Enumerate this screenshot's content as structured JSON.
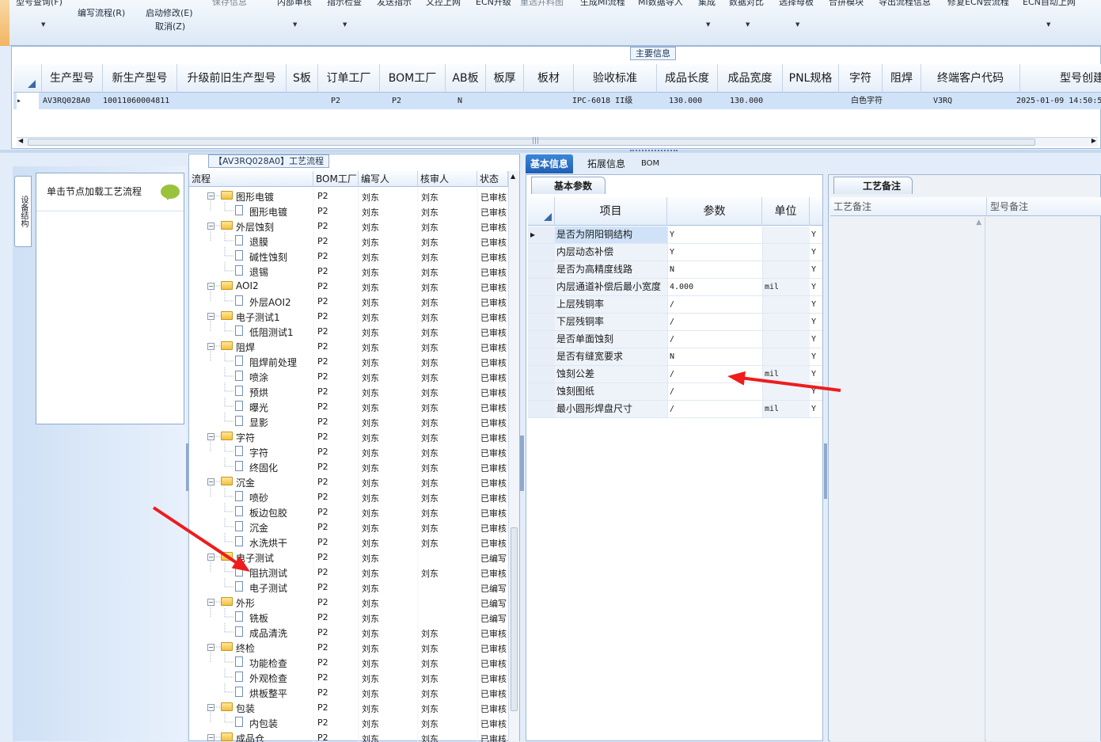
{
  "toolbar": {
    "items": [
      {
        "label": "型号查询(F)",
        "dim": false,
        "dropdown": true
      },
      {
        "label": "编写流程(R)",
        "dim": false,
        "dropdown": false
      },
      {
        "label": "启动修改(E)",
        "dim": false,
        "dropdown": false
      },
      {
        "label": "取消(Z)",
        "dim": false,
        "dropdown": false
      },
      {
        "label": "保存信息",
        "dim": true,
        "dropdown": false
      },
      {
        "label": "内部审核",
        "dim": false,
        "dropdown": true
      },
      {
        "label": "指示检查",
        "dim": false,
        "dropdown": true
      },
      {
        "label": "发送指示",
        "dim": false,
        "dropdown": false
      },
      {
        "label": "文控上网",
        "dim": false,
        "dropdown": false
      },
      {
        "label": "ECN升级",
        "dim": false,
        "dropdown": false
      },
      {
        "label": "重选并料图",
        "dim": true,
        "dropdown": false
      },
      {
        "label": "生成MI流程",
        "dim": false,
        "dropdown": false
      },
      {
        "label": "MI数据导入",
        "dim": false,
        "dropdown": false
      },
      {
        "label": "集成",
        "dim": false,
        "dropdown": true
      },
      {
        "label": "数据对比",
        "dim": false,
        "dropdown": true
      },
      {
        "label": "选择母板",
        "dim": false,
        "dropdown": true
      },
      {
        "label": "合拼模块",
        "dim": false,
        "dropdown": false
      },
      {
        "label": "导出流程信息",
        "dim": false,
        "dropdown": false
      },
      {
        "label": "修复ECN会流程",
        "dim": false,
        "dropdown": false
      },
      {
        "label": "ECN自动上网",
        "dim": false,
        "dropdown": true
      }
    ]
  },
  "main_info": {
    "group_title": "主要信息",
    "columns": [
      "生产型号",
      "新生产型号",
      "升级前旧生产型号",
      "S板",
      "订单工厂",
      "BOM工厂",
      "AB板",
      "板厚",
      "板材",
      "验收标准",
      "成品长度",
      "成品宽度",
      "PNL规格",
      "字符",
      "阻焊",
      "终端客户代码",
      "型号创建时"
    ],
    "row": [
      "AV3RQ028A0",
      "10011060004811",
      "",
      "",
      "P2",
      "P2",
      "N",
      "",
      "",
      "IPC-6018 II级",
      "130.000",
      "130.000",
      "",
      "白色字符",
      "",
      "V3RQ",
      "2025-01-09 14:50:53"
    ],
    "scroll_marker": "|||"
  },
  "left_nav": {
    "vertical_tab": "设备结构",
    "item_label": "单击节点加载工艺流程"
  },
  "process_tree": {
    "group_title": "【AV3RQ028A0】工艺流程",
    "columns": [
      "流程",
      "BOM工厂",
      "编写人",
      "核审人",
      "状态"
    ],
    "rows": [
      {
        "name": "图形电镀",
        "level": 1,
        "factory": "P2",
        "writer": "刘东",
        "reviewer": "刘东",
        "status": "已审核"
      },
      {
        "name": "图形电镀",
        "level": 2,
        "factory": "P2",
        "writer": "刘东",
        "reviewer": "刘东",
        "status": "已审核"
      },
      {
        "name": "外层蚀刻",
        "level": 1,
        "factory": "P2",
        "writer": "刘东",
        "reviewer": "刘东",
        "status": "已审核"
      },
      {
        "name": "退膜",
        "level": 2,
        "factory": "P2",
        "writer": "刘东",
        "reviewer": "刘东",
        "status": "已审核"
      },
      {
        "name": "碱性蚀刻",
        "level": 2,
        "factory": "P2",
        "writer": "刘东",
        "reviewer": "刘东",
        "status": "已审核"
      },
      {
        "name": "退锡",
        "level": 2,
        "factory": "P2",
        "writer": "刘东",
        "reviewer": "刘东",
        "status": "已审核"
      },
      {
        "name": "AOI2",
        "level": 1,
        "factory": "P2",
        "writer": "刘东",
        "reviewer": "刘东",
        "status": "已审核"
      },
      {
        "name": "外层AOI2",
        "level": 2,
        "factory": "P2",
        "writer": "刘东",
        "reviewer": "刘东",
        "status": "已审核"
      },
      {
        "name": "电子测试1",
        "level": 1,
        "factory": "P2",
        "writer": "刘东",
        "reviewer": "刘东",
        "status": "已审核"
      },
      {
        "name": "低阻测试1",
        "level": 2,
        "factory": "P2",
        "writer": "刘东",
        "reviewer": "刘东",
        "status": "已审核"
      },
      {
        "name": "阻焊",
        "level": 1,
        "factory": "P2",
        "writer": "刘东",
        "reviewer": "刘东",
        "status": "已审核"
      },
      {
        "name": "阻焊前处理",
        "level": 2,
        "factory": "P2",
        "writer": "刘东",
        "reviewer": "刘东",
        "status": "已审核"
      },
      {
        "name": "喷涂",
        "level": 2,
        "factory": "P2",
        "writer": "刘东",
        "reviewer": "刘东",
        "status": "已审核"
      },
      {
        "name": "预烘",
        "level": 2,
        "factory": "P2",
        "writer": "刘东",
        "reviewer": "刘东",
        "status": "已审核"
      },
      {
        "name": "曝光",
        "level": 2,
        "factory": "P2",
        "writer": "刘东",
        "reviewer": "刘东",
        "status": "已审核"
      },
      {
        "name": "显影",
        "level": 2,
        "factory": "P2",
        "writer": "刘东",
        "reviewer": "刘东",
        "status": "已审核"
      },
      {
        "name": "字符",
        "level": 1,
        "factory": "P2",
        "writer": "刘东",
        "reviewer": "刘东",
        "status": "已审核"
      },
      {
        "name": "字符",
        "level": 2,
        "factory": "P2",
        "writer": "刘东",
        "reviewer": "刘东",
        "status": "已审核"
      },
      {
        "name": "终固化",
        "level": 2,
        "factory": "P2",
        "writer": "刘东",
        "reviewer": "刘东",
        "status": "已审核"
      },
      {
        "name": "沉金",
        "level": 1,
        "factory": "P2",
        "writer": "刘东",
        "reviewer": "刘东",
        "status": "已审核"
      },
      {
        "name": "喷砂",
        "level": 2,
        "factory": "P2",
        "writer": "刘东",
        "reviewer": "刘东",
        "status": "已审核"
      },
      {
        "name": "板边包胶",
        "level": 2,
        "factory": "P2",
        "writer": "刘东",
        "reviewer": "刘东",
        "status": "已审核"
      },
      {
        "name": "沉金",
        "level": 2,
        "factory": "P2",
        "writer": "刘东",
        "reviewer": "刘东",
        "status": "已审核"
      },
      {
        "name": "水洗烘干",
        "level": 2,
        "factory": "P2",
        "writer": "刘东",
        "reviewer": "刘东",
        "status": "已审核"
      },
      {
        "name": "电子测试",
        "level": 1,
        "factory": "P2",
        "writer": "刘东",
        "reviewer": "",
        "status": "已编写"
      },
      {
        "name": "阻抗测试",
        "level": 2,
        "factory": "P2",
        "writer": "刘东",
        "reviewer": "刘东",
        "status": "已审核"
      },
      {
        "name": "电子测试",
        "level": 2,
        "factory": "P2",
        "writer": "刘东",
        "reviewer": "",
        "status": "已编写"
      },
      {
        "name": "外形",
        "level": 1,
        "factory": "P2",
        "writer": "刘东",
        "reviewer": "",
        "status": "已编写"
      },
      {
        "name": "铣板",
        "level": 2,
        "factory": "P2",
        "writer": "刘东",
        "reviewer": "",
        "status": "已编写"
      },
      {
        "name": "成品清洗",
        "level": 2,
        "factory": "P2",
        "writer": "刘东",
        "reviewer": "刘东",
        "status": "已审核"
      },
      {
        "name": "终检",
        "level": 1,
        "factory": "P2",
        "writer": "刘东",
        "reviewer": "刘东",
        "status": "已审核"
      },
      {
        "name": "功能检查",
        "level": 2,
        "factory": "P2",
        "writer": "刘东",
        "reviewer": "刘东",
        "status": "已审核"
      },
      {
        "name": "外观检查",
        "level": 2,
        "factory": "P2",
        "writer": "刘东",
        "reviewer": "刘东",
        "status": "已审核"
      },
      {
        "name": "烘板整平",
        "level": 2,
        "factory": "P2",
        "writer": "刘东",
        "reviewer": "刘东",
        "status": "已审核"
      },
      {
        "name": "包装",
        "level": 1,
        "factory": "P2",
        "writer": "刘东",
        "reviewer": "刘东",
        "status": "已审核"
      },
      {
        "name": "内包装",
        "level": 2,
        "factory": "P2",
        "writer": "刘东",
        "reviewer": "刘东",
        "status": "已审核"
      },
      {
        "name": "成品仓",
        "level": 1,
        "factory": "P2",
        "writer": "刘东",
        "reviewer": "刘东",
        "status": "已审核"
      }
    ]
  },
  "tabs": [
    "基本信息",
    "拓展信息",
    "BOM"
  ],
  "params": {
    "sub_tab": "基本参数",
    "columns": [
      "项目",
      "参数",
      "单位"
    ],
    "rows": [
      {
        "item": "是否为阴阳铜结构",
        "value": "Y",
        "unit": "",
        "flag": "Y"
      },
      {
        "item": "内层动态补偿",
        "value": "Y",
        "unit": "",
        "flag": "Y"
      },
      {
        "item": "是否为高精度线路",
        "value": "N",
        "unit": "",
        "flag": "Y"
      },
      {
        "item": "内层通道补偿后最小宽度",
        "value": "4.000",
        "unit": "mil",
        "flag": "Y"
      },
      {
        "item": "上层残铜率",
        "value": "/",
        "unit": "",
        "flag": "Y"
      },
      {
        "item": "下层残铜率",
        "value": "/",
        "unit": "",
        "flag": "Y"
      },
      {
        "item": "是否单面蚀刻",
        "value": "/",
        "unit": "",
        "flag": "Y"
      },
      {
        "item": "是否有缝宽要求",
        "value": "N",
        "unit": "",
        "flag": "Y"
      },
      {
        "item": "蚀刻公差",
        "value": "/",
        "unit": "mil",
        "flag": "Y"
      },
      {
        "item": "蚀刻图纸",
        "value": "/",
        "unit": "",
        "flag": "Y"
      },
      {
        "item": "最小圆形焊盘尺寸",
        "value": "/",
        "unit": "mil",
        "flag": "Y"
      }
    ]
  },
  "notes": {
    "tab": "工艺备注",
    "columns": [
      "工艺备注",
      "型号备注"
    ]
  },
  "colors": {
    "accent": "#1e5fb4",
    "selected_row": "#cfe2f8",
    "annotation_arrow": "#ee1c1c"
  }
}
